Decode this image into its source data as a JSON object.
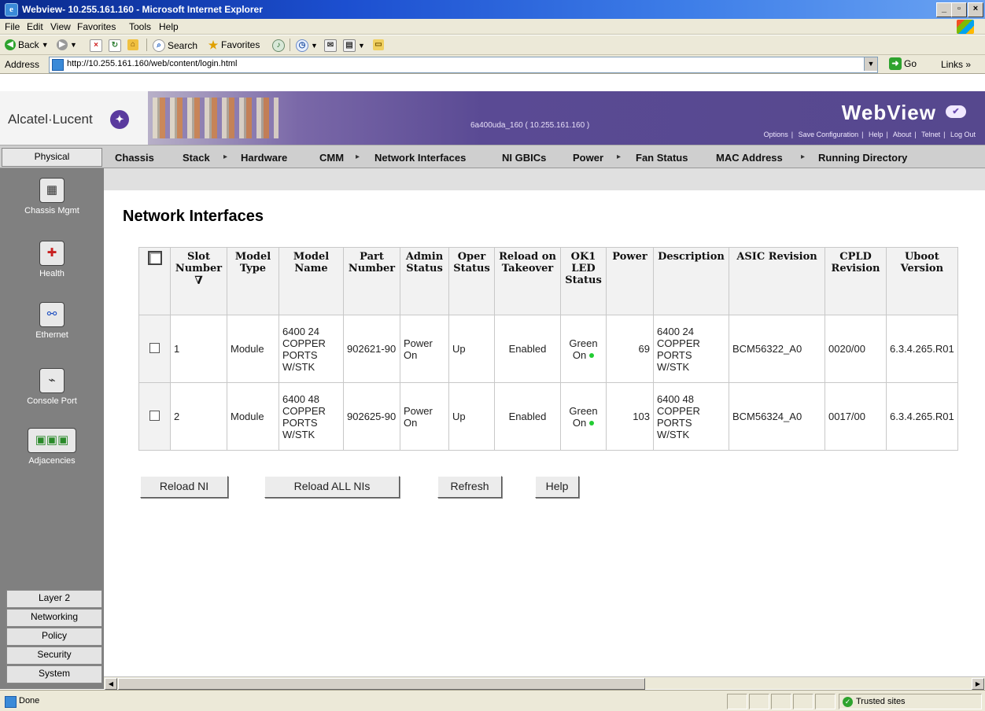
{
  "window": {
    "title": "Webview- 10.255.161.160 - Microsoft Internet Explorer",
    "min_glyph": "_",
    "max_glyph": "▫",
    "close_glyph": "×"
  },
  "menu": [
    "File",
    "Edit",
    "View",
    "Favorites",
    "Tools",
    "Help"
  ],
  "toolbar": {
    "back": "Back",
    "search": "Search",
    "favorites": "Favorites"
  },
  "address": {
    "label": "Address",
    "url": "http://10.255.161.160/web/content/login.html",
    "go": "Go",
    "links": "Links »"
  },
  "header": {
    "logo_text": "Alcatel·Lucent",
    "device_id": "6a400uda_160 ( 10.255.161.160 )",
    "brand": "WebView",
    "links": [
      "Options",
      "Save Configuration",
      "Help",
      "About",
      "Telnet",
      "Log Out"
    ]
  },
  "nav": {
    "physical_tab": "Physical",
    "items": [
      "Chassis",
      "Stack",
      "Hardware",
      "CMM",
      "Network Interfaces",
      "NI GBICs",
      "Power",
      "Fan Status",
      "MAC Address",
      "Running Directory"
    ]
  },
  "sidebar": {
    "items": [
      "Chassis Mgmt",
      "Health",
      "Ethernet",
      "Console Port",
      "Adjacencies"
    ],
    "tabs": [
      "Layer 2",
      "Networking",
      "Policy",
      "Security",
      "System"
    ]
  },
  "page": {
    "title": "Network Interfaces"
  },
  "table": {
    "headers": [
      "Slot Number",
      "Model Type",
      "Model Name",
      "Part Number",
      "Admin Status",
      "Oper Status",
      "Reload on Takeover",
      "OK1 LED Status",
      "Power",
      "Description",
      "ASIC Revision",
      "CPLD Revision",
      "Uboot Version"
    ],
    "sort_glyph": "∇",
    "rows": [
      {
        "slot": "1",
        "model_type": "Module",
        "model_name": "6400 24 COPPER PORTS W/STK",
        "part_number": "902621-90",
        "admin_status": "Power On",
        "oper_status": "Up",
        "reload_on_takeover": "Enabled",
        "led_status": "Green On",
        "power": "69",
        "description": "6400 24 COPPER PORTS W/STK",
        "asic_revision": "BCM56322_A0",
        "cpld_revision": "0020/00",
        "uboot_version": "6.3.4.265.R01"
      },
      {
        "slot": "2",
        "model_type": "Module",
        "model_name": "6400 48 COPPER PORTS W/STK",
        "part_number": "902625-90",
        "admin_status": "Power On",
        "oper_status": "Up",
        "reload_on_takeover": "Enabled",
        "led_status": "Green On",
        "power": "103",
        "description": "6400 48 COPPER PORTS W/STK",
        "asic_revision": "BCM56324_A0",
        "cpld_revision": "0017/00",
        "uboot_version": "6.3.4.265.R01"
      }
    ]
  },
  "buttons": {
    "reload_ni": "Reload NI",
    "reload_all": "Reload ALL NIs",
    "refresh": "Refresh",
    "help": "Help"
  },
  "status": {
    "text": "Done",
    "zone": "Trusted sites"
  },
  "colors": {
    "banner": "#56488e",
    "led_green": "#22cc33",
    "sidebar": "#808080"
  }
}
